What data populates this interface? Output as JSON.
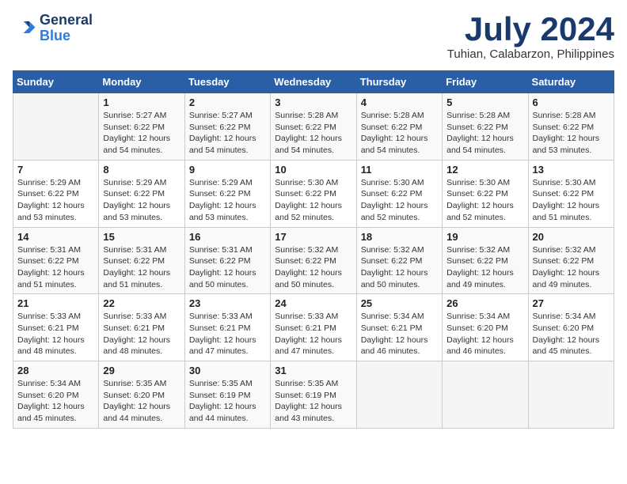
{
  "header": {
    "logo_line1": "General",
    "logo_line2": "Blue",
    "month": "July 2024",
    "location": "Tuhian, Calabarzon, Philippines"
  },
  "weekdays": [
    "Sunday",
    "Monday",
    "Tuesday",
    "Wednesday",
    "Thursday",
    "Friday",
    "Saturday"
  ],
  "weeks": [
    [
      {
        "day": "",
        "info": ""
      },
      {
        "day": "1",
        "info": "Sunrise: 5:27 AM\nSunset: 6:22 PM\nDaylight: 12 hours\nand 54 minutes."
      },
      {
        "day": "2",
        "info": "Sunrise: 5:27 AM\nSunset: 6:22 PM\nDaylight: 12 hours\nand 54 minutes."
      },
      {
        "day": "3",
        "info": "Sunrise: 5:28 AM\nSunset: 6:22 PM\nDaylight: 12 hours\nand 54 minutes."
      },
      {
        "day": "4",
        "info": "Sunrise: 5:28 AM\nSunset: 6:22 PM\nDaylight: 12 hours\nand 54 minutes."
      },
      {
        "day": "5",
        "info": "Sunrise: 5:28 AM\nSunset: 6:22 PM\nDaylight: 12 hours\nand 54 minutes."
      },
      {
        "day": "6",
        "info": "Sunrise: 5:28 AM\nSunset: 6:22 PM\nDaylight: 12 hours\nand 53 minutes."
      }
    ],
    [
      {
        "day": "7",
        "info": "Sunrise: 5:29 AM\nSunset: 6:22 PM\nDaylight: 12 hours\nand 53 minutes."
      },
      {
        "day": "8",
        "info": "Sunrise: 5:29 AM\nSunset: 6:22 PM\nDaylight: 12 hours\nand 53 minutes."
      },
      {
        "day": "9",
        "info": "Sunrise: 5:29 AM\nSunset: 6:22 PM\nDaylight: 12 hours\nand 53 minutes."
      },
      {
        "day": "10",
        "info": "Sunrise: 5:30 AM\nSunset: 6:22 PM\nDaylight: 12 hours\nand 52 minutes."
      },
      {
        "day": "11",
        "info": "Sunrise: 5:30 AM\nSunset: 6:22 PM\nDaylight: 12 hours\nand 52 minutes."
      },
      {
        "day": "12",
        "info": "Sunrise: 5:30 AM\nSunset: 6:22 PM\nDaylight: 12 hours\nand 52 minutes."
      },
      {
        "day": "13",
        "info": "Sunrise: 5:30 AM\nSunset: 6:22 PM\nDaylight: 12 hours\nand 51 minutes."
      }
    ],
    [
      {
        "day": "14",
        "info": "Sunrise: 5:31 AM\nSunset: 6:22 PM\nDaylight: 12 hours\nand 51 minutes."
      },
      {
        "day": "15",
        "info": "Sunrise: 5:31 AM\nSunset: 6:22 PM\nDaylight: 12 hours\nand 51 minutes."
      },
      {
        "day": "16",
        "info": "Sunrise: 5:31 AM\nSunset: 6:22 PM\nDaylight: 12 hours\nand 50 minutes."
      },
      {
        "day": "17",
        "info": "Sunrise: 5:32 AM\nSunset: 6:22 PM\nDaylight: 12 hours\nand 50 minutes."
      },
      {
        "day": "18",
        "info": "Sunrise: 5:32 AM\nSunset: 6:22 PM\nDaylight: 12 hours\nand 50 minutes."
      },
      {
        "day": "19",
        "info": "Sunrise: 5:32 AM\nSunset: 6:22 PM\nDaylight: 12 hours\nand 49 minutes."
      },
      {
        "day": "20",
        "info": "Sunrise: 5:32 AM\nSunset: 6:22 PM\nDaylight: 12 hours\nand 49 minutes."
      }
    ],
    [
      {
        "day": "21",
        "info": "Sunrise: 5:33 AM\nSunset: 6:21 PM\nDaylight: 12 hours\nand 48 minutes."
      },
      {
        "day": "22",
        "info": "Sunrise: 5:33 AM\nSunset: 6:21 PM\nDaylight: 12 hours\nand 48 minutes."
      },
      {
        "day": "23",
        "info": "Sunrise: 5:33 AM\nSunset: 6:21 PM\nDaylight: 12 hours\nand 47 minutes."
      },
      {
        "day": "24",
        "info": "Sunrise: 5:33 AM\nSunset: 6:21 PM\nDaylight: 12 hours\nand 47 minutes."
      },
      {
        "day": "25",
        "info": "Sunrise: 5:34 AM\nSunset: 6:21 PM\nDaylight: 12 hours\nand 46 minutes."
      },
      {
        "day": "26",
        "info": "Sunrise: 5:34 AM\nSunset: 6:20 PM\nDaylight: 12 hours\nand 46 minutes."
      },
      {
        "day": "27",
        "info": "Sunrise: 5:34 AM\nSunset: 6:20 PM\nDaylight: 12 hours\nand 45 minutes."
      }
    ],
    [
      {
        "day": "28",
        "info": "Sunrise: 5:34 AM\nSunset: 6:20 PM\nDaylight: 12 hours\nand 45 minutes."
      },
      {
        "day": "29",
        "info": "Sunrise: 5:35 AM\nSunset: 6:20 PM\nDaylight: 12 hours\nand 44 minutes."
      },
      {
        "day": "30",
        "info": "Sunrise: 5:35 AM\nSunset: 6:19 PM\nDaylight: 12 hours\nand 44 minutes."
      },
      {
        "day": "31",
        "info": "Sunrise: 5:35 AM\nSunset: 6:19 PM\nDaylight: 12 hours\nand 43 minutes."
      },
      {
        "day": "",
        "info": ""
      },
      {
        "day": "",
        "info": ""
      },
      {
        "day": "",
        "info": ""
      }
    ]
  ]
}
